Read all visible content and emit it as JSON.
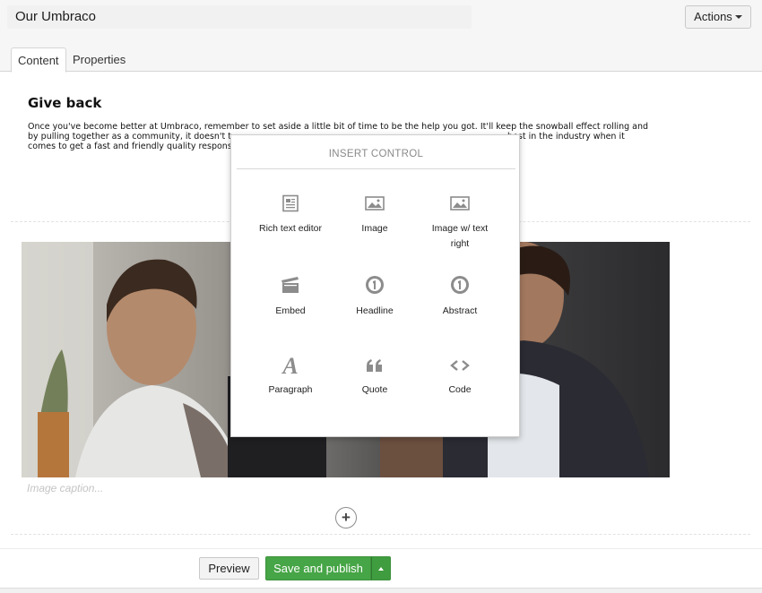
{
  "header": {
    "name_value": "Our Umbraco",
    "actions_label": "Actions"
  },
  "tabs": [
    {
      "label": "Content",
      "active": true
    },
    {
      "label": "Properties",
      "active": false
    }
  ],
  "content": {
    "heading": "Give back",
    "paragraph_visible_lines": [
      "Once you've become better at Umbraco, remember to set aside a little bit of time to be the help you got. It'll keep the snowball effect rolling and",
      "by pulling together as a community, it doesn't t",
      "best in the industry when it",
      "comes to get a fast and friendly quality respons"
    ],
    "image_caption_placeholder": "Image caption..."
  },
  "insert_control": {
    "title": "INSERT CONTROL",
    "items": [
      {
        "label": "Rich text editor",
        "icon": "rich-text-editor-icon"
      },
      {
        "label": "Image",
        "icon": "image-icon"
      },
      {
        "label": "Image w/ text right",
        "icon": "image-with-text-icon"
      },
      {
        "label": "Embed",
        "icon": "clapperboard-icon"
      },
      {
        "label": "Headline",
        "icon": "number-one-circle-icon"
      },
      {
        "label": "Abstract",
        "icon": "number-one-circle-icon"
      },
      {
        "label": "Paragraph",
        "icon": "letter-a-icon"
      },
      {
        "label": "Quote",
        "icon": "quote-icon"
      },
      {
        "label": "Code",
        "icon": "code-brackets-icon"
      }
    ]
  },
  "buttons": {
    "preview_label": "Preview",
    "save_publish_label": "Save and publish"
  },
  "colors": {
    "save_green": "#46a546",
    "modal_title_gray": "#8a8a8a",
    "icon_gray": "#8c8c8c"
  }
}
